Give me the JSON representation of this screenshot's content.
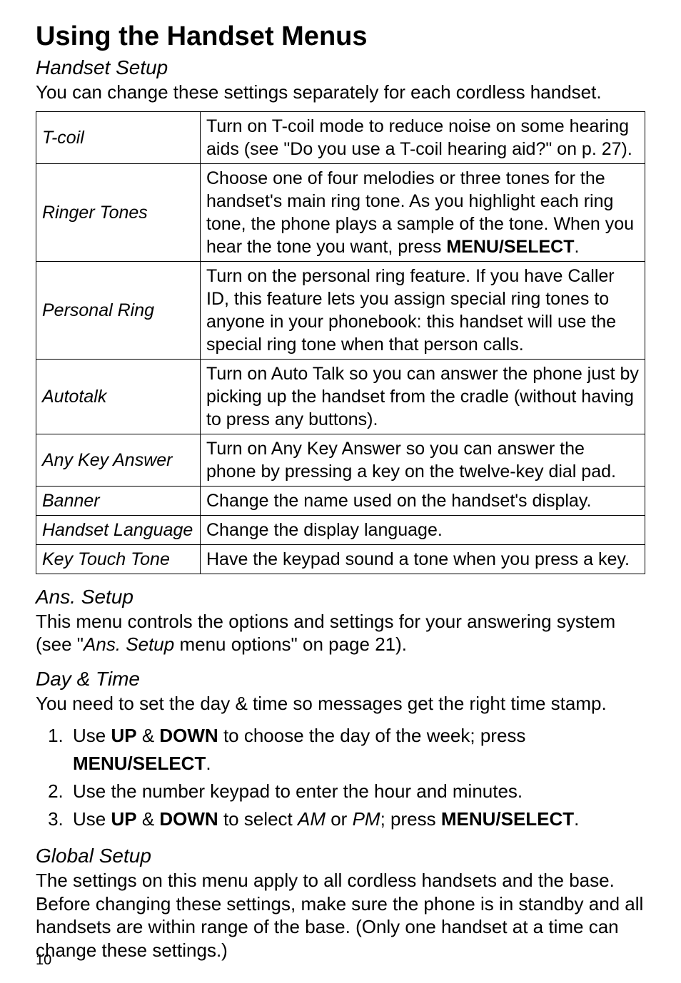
{
  "heading": "Using the Handset Menus",
  "handset_setup": {
    "title": "Handset Setup",
    "intro": "You can change these settings separately for each cordless handset.",
    "rows": [
      {
        "label": "T-coil",
        "desc_pre": "Turn on T-coil mode to reduce noise on some hearing aids (see \"Do you use a T-coil hearing aid?\" on p. 27).",
        "desc_key": "",
        "desc_post": ""
      },
      {
        "label": "Ringer Tones",
        "desc_pre": "Choose one of four melodies or three tones for the handset's main ring tone. As you highlight each ring tone, the phone plays a sample of the tone. When you hear the tone you want, press ",
        "desc_key": "MENU/SELECT",
        "desc_post": "."
      },
      {
        "label": "Personal Ring",
        "desc_pre": "Turn on the personal ring feature. If you have Caller ID, this feature lets you assign special ring tones to anyone in your phonebook: this handset will use the special ring tone when that person calls.",
        "desc_key": "",
        "desc_post": ""
      },
      {
        "label": "Autotalk",
        "desc_pre": "Turn on Auto Talk so you can answer the phone just by picking up the handset from the cradle (without having to press any buttons).",
        "desc_key": "",
        "desc_post": ""
      },
      {
        "label": "Any Key Answer",
        "desc_pre": "Turn on Any Key Answer so you can answer the phone by pressing a key on the twelve-key dial pad.",
        "desc_key": "",
        "desc_post": ""
      },
      {
        "label": "Banner",
        "desc_pre": "Change the name used on the handset's display.",
        "desc_key": "",
        "desc_post": ""
      },
      {
        "label": "Handset Language",
        "desc_pre": "Change the display language.",
        "desc_key": "",
        "desc_post": ""
      },
      {
        "label": "Key Touch Tone",
        "desc_pre": "Have the keypad sound a tone when you press a key.",
        "desc_key": "",
        "desc_post": ""
      }
    ]
  },
  "ans_setup": {
    "title": "Ans. Setup",
    "body_pre": "This menu controls the options and settings for your answering system (see \"",
    "body_ital": "Ans. Setup",
    "body_post": " menu options\" on page 21)."
  },
  "day_time": {
    "title": "Day & Time",
    "intro": "You need to set the day & time so messages get the right time stamp.",
    "step1": {
      "pre": "Use ",
      "up": "UP",
      "amp": " & ",
      "down": "DOWN",
      "mid": " to choose the day of the week; press ",
      "menu": "MENU/SELECT",
      "post": "."
    },
    "step2": "Use the number keypad to enter the hour and minutes.",
    "step3": {
      "pre": "Use ",
      "up": "UP",
      "amp": " & ",
      "down": "DOWN",
      "mid1": " to select ",
      "am": "AM",
      "or": " or ",
      "pm": "PM",
      "mid2": "; press ",
      "menu": "MENU/SELECT",
      "post": "."
    }
  },
  "global_setup": {
    "title": "Global Setup",
    "body": "The settings on this menu apply to all cordless handsets and the base. Before changing these settings, make sure the phone is in standby and all handsets are within range of the base. (Only one handset at a  time can change these settings.)"
  },
  "page_number": "10"
}
